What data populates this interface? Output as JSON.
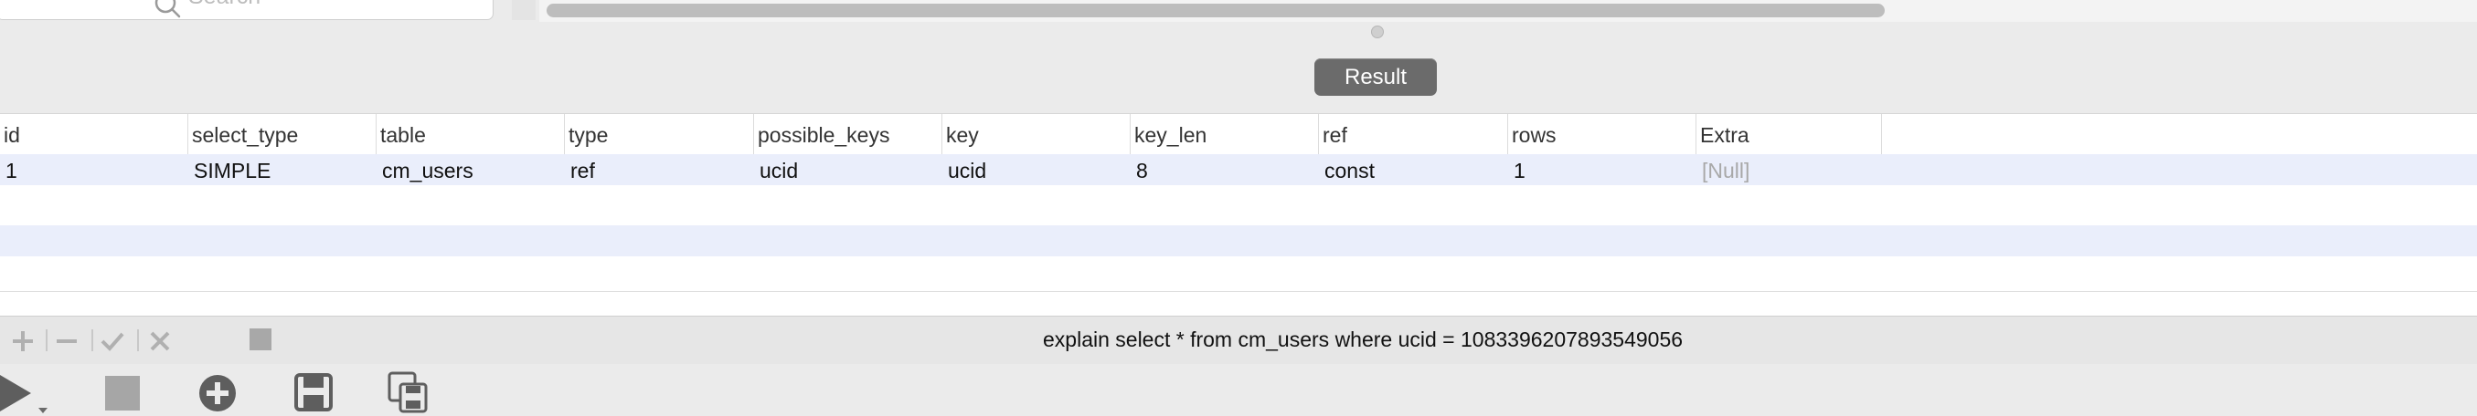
{
  "search": {
    "placeholder": "Search"
  },
  "result_tab": {
    "label": "Result"
  },
  "table": {
    "columns": [
      "id",
      "select_type",
      "table",
      "type",
      "possible_keys",
      "key",
      "key_len",
      "ref",
      "rows",
      "Extra"
    ],
    "rows": [
      [
        "1",
        "SIMPLE",
        "cm_users",
        "ref",
        "ucid",
        "ucid",
        "8",
        "const",
        "1",
        "[Null]"
      ]
    ]
  },
  "status": {
    "query": "explain select * from cm_users where ucid = 1083396207893549056"
  },
  "icons": {
    "search": "search-icon",
    "add_row": "plus-icon",
    "remove_row": "minus-icon",
    "apply": "checkmark-icon",
    "discard": "x-icon",
    "stop_small": "stop-icon",
    "run": "play-icon",
    "stop": "stop-icon",
    "new": "add-circle-icon",
    "save": "save-icon",
    "save_copy": "save-copy-icon"
  },
  "colors": {
    "result_button_bg": "#6b6b6b",
    "row_tint": "#eaeefb",
    "null_text": "#a8a8a8"
  }
}
